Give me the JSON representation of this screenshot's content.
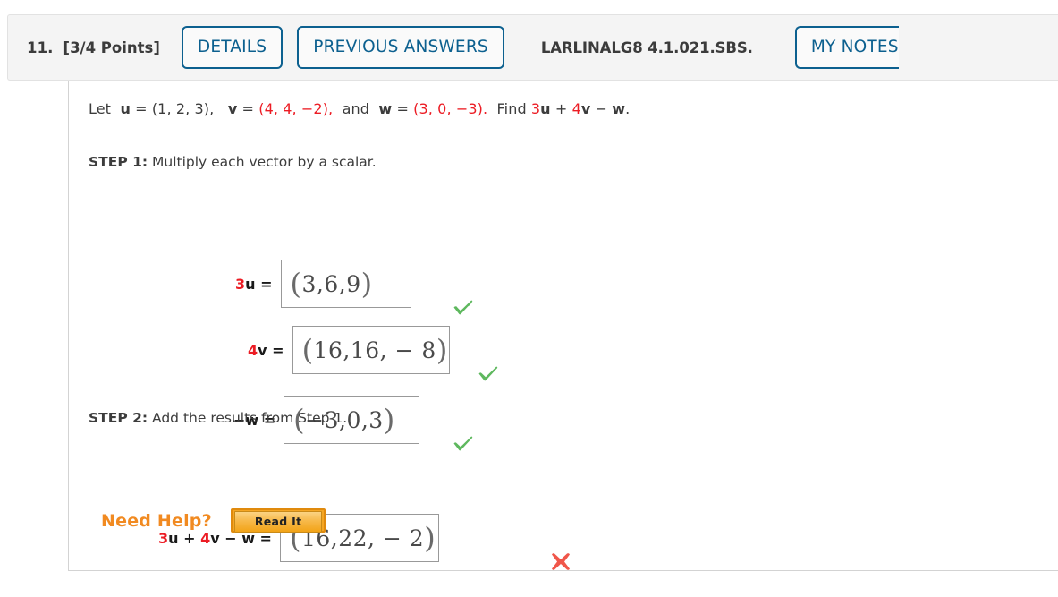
{
  "header": {
    "question_number": "11.",
    "points": "[3/4 Points]",
    "details_label": "DETAILS",
    "previous_answers_label": "PREVIOUS ANSWERS",
    "textbook_code": "LARLINALG8 4.1.021.SBS.",
    "my_notes_label": "MY NOTES",
    "accent_color": "#0c608f",
    "background_color": "#f4f4f4"
  },
  "problem": {
    "lead": "Let",
    "u_label": "u",
    "eq1": " = ",
    "u_value": "(1, 2, 3),",
    "v_label": "v",
    "v_value": "(4, 4, −2),",
    "and_text": "and",
    "w_label": "w",
    "w_value": "(3, 0, −3).",
    "find_text": "Find",
    "find_expr_3": "3",
    "find_expr_u": "u",
    "find_expr_plus": " + ",
    "find_expr_4": "4",
    "find_expr_v": "v",
    "find_expr_minus": " − ",
    "find_expr_w": "w",
    "find_expr_period": "."
  },
  "step1": {
    "label": "STEP 1:",
    "text": "Multiply each vector by a scalar.",
    "rows": [
      {
        "coef": "3",
        "vector": "u",
        "equals": " = ",
        "answer_open": "(",
        "answer": "3,6,9",
        "answer_close": ")",
        "status": "correct",
        "status_icon": "green-check-icon"
      },
      {
        "coef": "4",
        "vector": "v",
        "equals": " = ",
        "answer_open": "(",
        "answer": "16,16, − 8",
        "answer_close": ")",
        "status": "correct",
        "status_icon": "green-check-icon"
      },
      {
        "coef": "−",
        "vector": "w",
        "equals": " = ",
        "answer_open": "(",
        "answer": "−3,0,3",
        "answer_close": ")",
        "status": "correct",
        "status_icon": "green-check-icon"
      }
    ]
  },
  "step2": {
    "label": "STEP 2:",
    "text": "Add the results from Step 1.",
    "row": {
      "t3": "3",
      "tu": "u",
      "tplus": " + ",
      "t4": "4",
      "tv": "v",
      "tminus": " − ",
      "tw": "w",
      "equals": " = ",
      "answer_open": "(",
      "answer": "16,22, − 2",
      "answer_close": ")",
      "status": "incorrect",
      "status_icon": "red-x-icon"
    }
  },
  "need_help": {
    "label": "Need Help?",
    "read_it_label": "Read It",
    "label_color": "#f18a21",
    "button_color": "#f5a623"
  },
  "colors": {
    "red": "#ec1c24",
    "green_check": "#5eb85e",
    "red_x": "#f0564a",
    "box_border": "#999999",
    "panel_border": "#d3d3d3"
  }
}
